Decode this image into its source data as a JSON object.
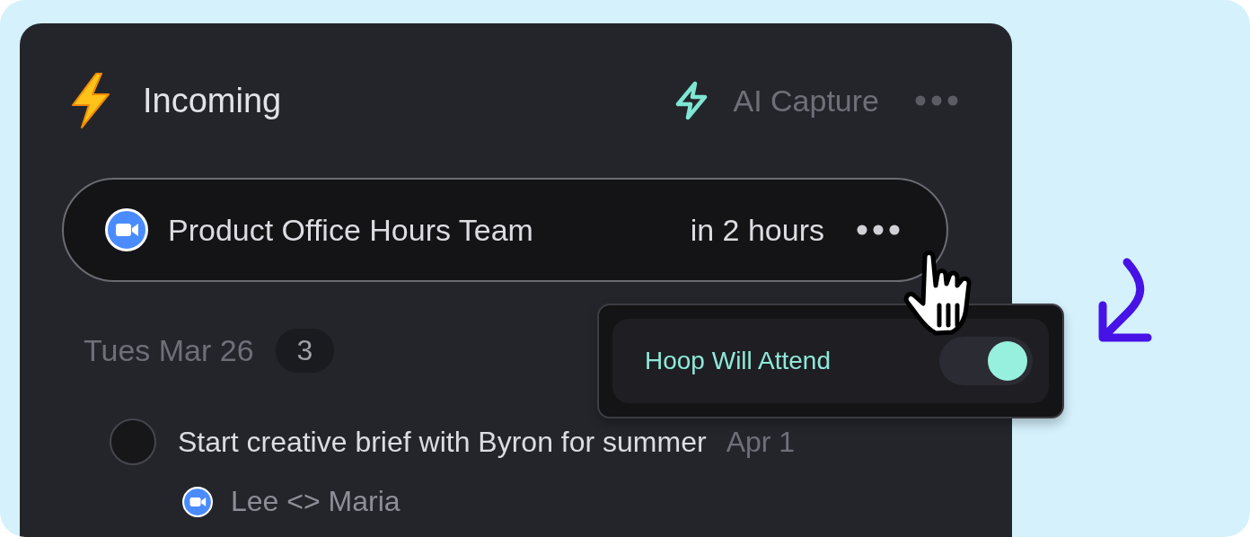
{
  "header": {
    "title": "Incoming",
    "action": "AI Capture"
  },
  "event": {
    "title": "Product Office Hours Team",
    "time": "in 2 hours"
  },
  "popover": {
    "label": "Hoop Will Attend",
    "on": true
  },
  "date_group": {
    "label": "Tues Mar 26",
    "count": "3"
  },
  "tasks": [
    {
      "title": "Start creative brief with Byron for summer",
      "due": "Apr 1",
      "checked": false,
      "meeting": "Lee <> Maria"
    }
  ]
}
